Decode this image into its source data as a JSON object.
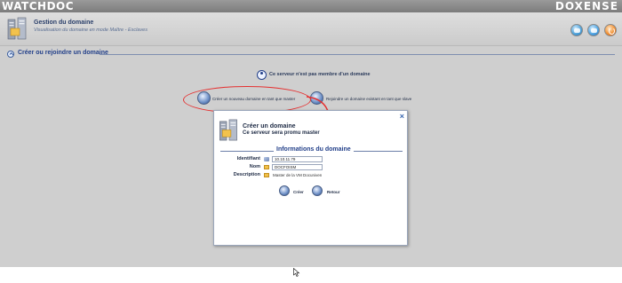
{
  "brand": {
    "left_logo": "WATCHDOC",
    "right_logo": "DOXENSE"
  },
  "header": {
    "title": "Gestion du domaine",
    "subtitle": "Visualisation du domaine en mode Maître - Esclaves"
  },
  "section": {
    "title": "Créer ou rejoindre un domaine"
  },
  "status": {
    "text": "Ce serveur n'est pas membre d'un domaine"
  },
  "actions": {
    "create": "Créer un nouveau domaine en tant que master",
    "join": "Rejoindre un domaine existant en tant que slave"
  },
  "modal": {
    "close": "×",
    "title": "Créer un domaine",
    "subtitle": "Ce serveur sera promu master",
    "section_title": "Informations du domaine",
    "fields": {
      "identifiant_label": "Identifiant",
      "identifiant_value": "10.10.11.79",
      "nom_label": "Nom",
      "nom_value": "DOCFOISM",
      "description_label": "Description",
      "description_value": "Master de la VM Docuniven"
    },
    "buttons": {
      "create": "Créer",
      "back": "Retour"
    }
  },
  "colors": {
    "accent": "#24418a",
    "highlight": "#e53030"
  }
}
